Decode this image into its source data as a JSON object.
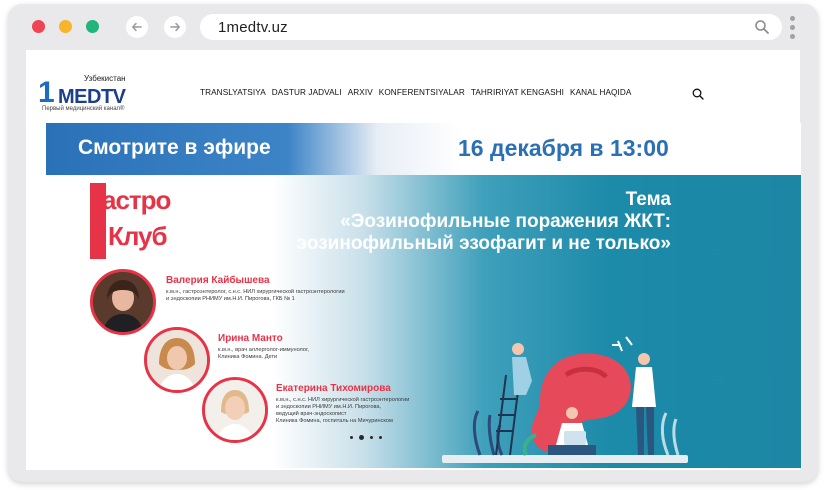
{
  "browser": {
    "url": "1medtv.uz",
    "back_icon": "arrow-left-icon",
    "forward_icon": "arrow-right-icon",
    "search_icon": "search-icon",
    "menu_icon": "kebab-menu-icon"
  },
  "site": {
    "logo_number": "1",
    "logo_text": "MEDTV",
    "logo_country": "Узбекистан",
    "logo_tagline": "Первый медицинский канал®"
  },
  "nav": {
    "items": [
      "TRANSLYATSIYA",
      "DASTUR JADVALI",
      "ARXIV",
      "KONFERENTSIYALAR",
      "TAHRIRIYAT KENGASHI",
      "KANAL HAQIDA"
    ],
    "search_icon": "search-icon"
  },
  "banner": {
    "watch_live": "Смотрите в эфире",
    "datetime": "16 декабря в 13:00",
    "club_line1": "астро",
    "club_line2": "Клуб",
    "topic_lines": [
      "Тема",
      "«Эозинофильные поражения ЖКТ:",
      "эозинофильный эзофагит и не только»"
    ],
    "speakers": [
      {
        "name": "Валерия Кайбышева",
        "desc": [
          "к.м.н., гастроэнтеролог, с.н.с. НИЛ хирургической гастроэнтерологии",
          "и эндоскопии РНИМУ им.Н.И. Пирогова, ГКБ № 1"
        ]
      },
      {
        "name": "Ирина Манто",
        "desc": [
          "к.м.н., врач аллерголог-иммунолог,",
          "Клиника Фомина. Дети"
        ]
      },
      {
        "name": "Екатерина Тихомирова",
        "desc": [
          "к.м.н., с.н.с. НИЛ хирургической гастроэнтерологии",
          "и эндоскопии РНИМУ им.Н.И. Пирогова,",
          "ведущий врач-эндоскопист",
          "Клиника Фомина, госпиталь на Мичуринском"
        ]
      }
    ],
    "slides_total": 4,
    "slide_active": 2
  },
  "colors": {
    "brand_blue": "#1b6dc1",
    "accent_red": "#e63347",
    "teal": "#1d86a5"
  }
}
